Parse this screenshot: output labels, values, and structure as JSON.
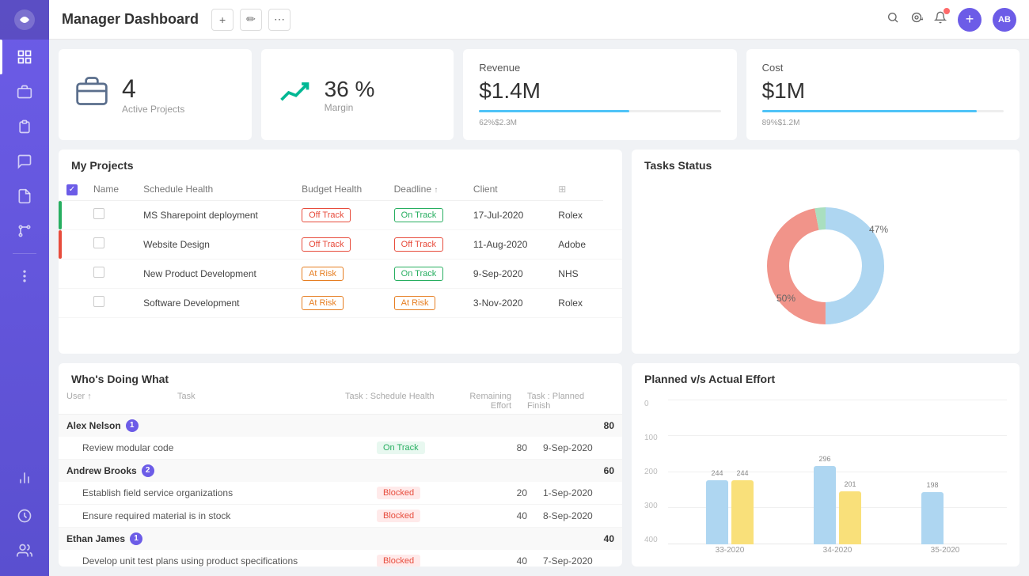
{
  "header": {
    "title": "Manager Dashboard",
    "add_btn": "+",
    "avatar_initials": "AB"
  },
  "stats": {
    "active_projects": {
      "number": "4",
      "label": "Active Projects"
    },
    "margin": {
      "value": "36 %",
      "label": "Margin"
    },
    "revenue": {
      "header": "Revenue",
      "value": "$1.4M",
      "progress_pct": 62,
      "progress_label_left": "62%",
      "progress_label_right": "$2.3M"
    },
    "cost": {
      "header": "Cost",
      "value": "$1M",
      "progress_pct": 89,
      "progress_label_left": "89%",
      "progress_label_right": "$1.2M"
    }
  },
  "my_projects": {
    "title": "My Projects",
    "columns": [
      "Name",
      "Schedule Health",
      "Budget Health",
      "Deadline",
      "Client"
    ],
    "rows": [
      {
        "name": "MS Sharepoint deployment",
        "schedule": "Off Track",
        "schedule_type": "red",
        "budget": "On Track",
        "budget_type": "green",
        "deadline": "17-Jul-2020",
        "client": "Rolex",
        "indicator": "green"
      },
      {
        "name": "Website Design",
        "schedule": "Off Track",
        "schedule_type": "red",
        "budget": "Off Track",
        "budget_type": "red",
        "deadline": "11-Aug-2020",
        "client": "Adobe",
        "indicator": "red"
      },
      {
        "name": "New Product Development",
        "schedule": "At Risk",
        "schedule_type": "orange",
        "budget": "On Track",
        "budget_type": "green",
        "deadline": "9-Sep-2020",
        "client": "NHS",
        "indicator": "none"
      },
      {
        "name": "Software Development",
        "schedule": "At Risk",
        "schedule_type": "orange",
        "budget": "At Risk",
        "budget_type": "orange",
        "deadline": "3-Nov-2020",
        "client": "Rolex",
        "indicator": "none"
      }
    ]
  },
  "tasks_status": {
    "title": "Tasks Status",
    "segments": [
      {
        "label": "50%",
        "color": "#aed6f1",
        "pct": 50
      },
      {
        "label": "47%",
        "color": "#f1948a",
        "pct": 47
      },
      {
        "label": "3%",
        "color": "#a9dfbf",
        "pct": 3
      }
    ]
  },
  "whos_doing_what": {
    "title": "Who's Doing What",
    "columns": [
      "User",
      "Task",
      "Task : Schedule Health",
      "Remaining Effort",
      "Task : Planned Finish"
    ],
    "groups": [
      {
        "name": "Alex Nelson",
        "count": 1,
        "total": 80,
        "tasks": [
          {
            "name": "Review modular code",
            "health": "On Track",
            "health_type": "ontrack",
            "remaining": 80,
            "finish": "9-Sep-2020"
          }
        ]
      },
      {
        "name": "Andrew Brooks",
        "count": 2,
        "total": 60,
        "tasks": [
          {
            "name": "Establish field service organizations",
            "health": "Blocked",
            "health_type": "blocked",
            "remaining": 20,
            "finish": "1-Sep-2020"
          },
          {
            "name": "Ensure required material is in stock",
            "health": "Blocked",
            "health_type": "blocked",
            "remaining": 40,
            "finish": "8-Sep-2020"
          }
        ]
      },
      {
        "name": "Ethan James",
        "count": 1,
        "total": 40,
        "tasks": [
          {
            "name": "Develop unit test plans using product specifications",
            "health": "Blocked",
            "health_type": "blocked",
            "remaining": 40,
            "finish": "7-Sep-2020"
          }
        ]
      }
    ]
  },
  "planned_effort": {
    "title": "Planned v/s Actual Effort",
    "y_labels": [
      "0",
      "100",
      "200",
      "300",
      "400"
    ],
    "groups": [
      {
        "label": "33-2020",
        "planned": 244,
        "actual": 244,
        "planned_h": 81,
        "actual_h": 81
      },
      {
        "label": "34-2020",
        "planned": 296,
        "actual": 201,
        "planned_h": 99,
        "actual_h": 67
      },
      {
        "label": "35-2020",
        "planned": 198,
        "actual": 0,
        "planned_h": 66,
        "actual_h": 0
      }
    ],
    "max": 400
  }
}
